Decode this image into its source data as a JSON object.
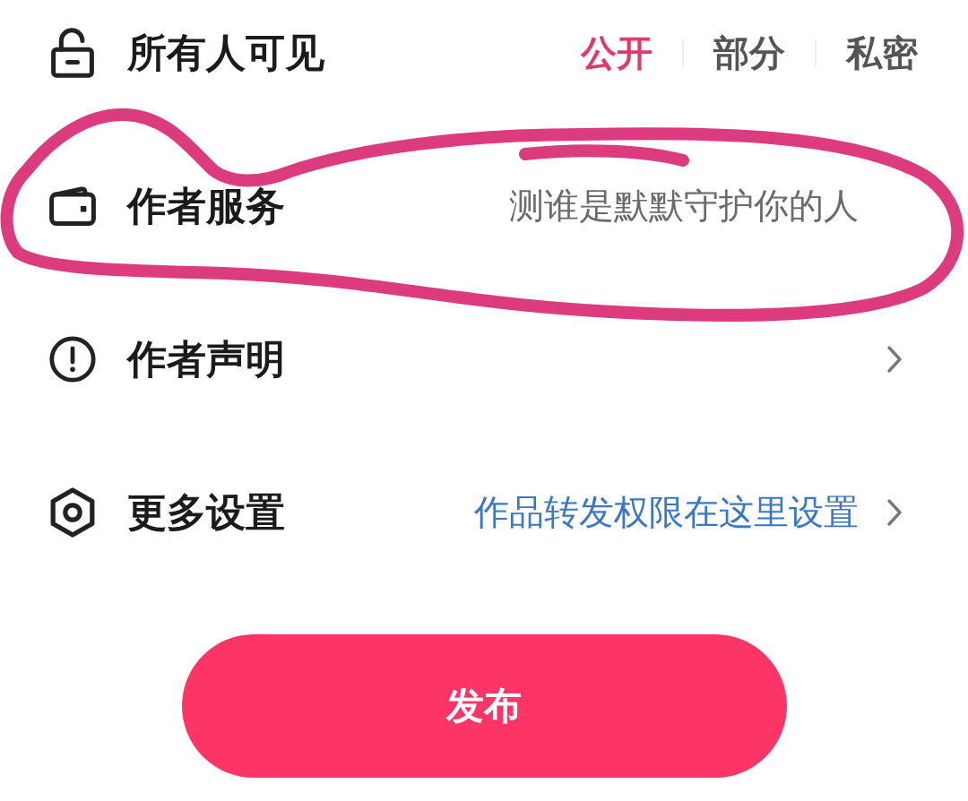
{
  "visibility": {
    "label": "所有人可见",
    "options": [
      {
        "label": "公开",
        "selected": true
      },
      {
        "label": "部分",
        "selected": false
      },
      {
        "label": "私密",
        "selected": false
      }
    ]
  },
  "rows": [
    {
      "kind": "hint",
      "label": "作者服务",
      "value": "测谁是默默守护你的人",
      "chevron": false,
      "circled": true
    },
    {
      "kind": "plain",
      "label": "作者声明",
      "chevron": true,
      "circled": false
    },
    {
      "kind": "link",
      "label": "更多设置",
      "value": "作品转发权限在这里设置",
      "chevron": true,
      "circled": false
    }
  ],
  "publish_button": {
    "label": "发布"
  }
}
